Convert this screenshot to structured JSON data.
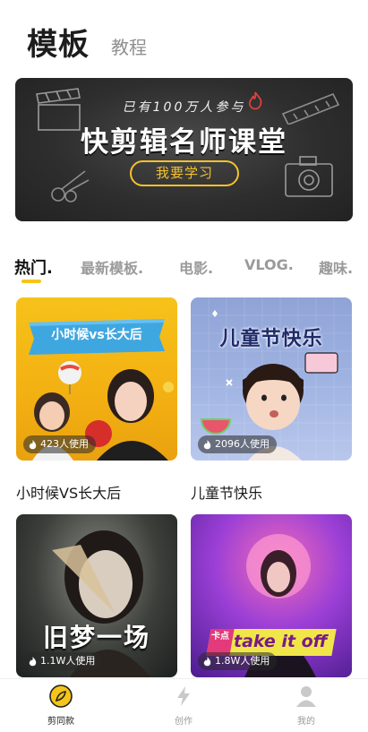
{
  "header": {
    "title": "模板",
    "tab_tutorial": "教程"
  },
  "banner": {
    "subtitle": "已有100万人参与",
    "title": "快剪辑名师课堂",
    "button": "我要学习"
  },
  "categories": [
    {
      "label": "热门."
    },
    {
      "label": "最新模板."
    },
    {
      "label": "电影."
    },
    {
      "label": "VLOG."
    },
    {
      "label": "趣味."
    }
  ],
  "templates": [
    {
      "title": "小时候VS长大后",
      "overlay_text": "小时候vs长大后",
      "usage": "423人使用"
    },
    {
      "title": "儿童节快乐",
      "overlay_text": "儿童节快乐",
      "usage": "2096人使用"
    },
    {
      "title": "",
      "overlay_text": "旧梦一场",
      "usage": "1.1W人使用"
    },
    {
      "title": "",
      "overlay_text": "take it off",
      "overlay_tag": "卡点",
      "usage": "1.8W人使用"
    }
  ],
  "bottom_nav": [
    {
      "label": "剪同款",
      "icon": "leaf-icon"
    },
    {
      "label": "创作",
      "icon": "lightning-icon"
    },
    {
      "label": "我的",
      "icon": "person-icon"
    }
  ],
  "colors": {
    "accent": "#f5c518",
    "banner_bg": "#2e2e2e"
  }
}
